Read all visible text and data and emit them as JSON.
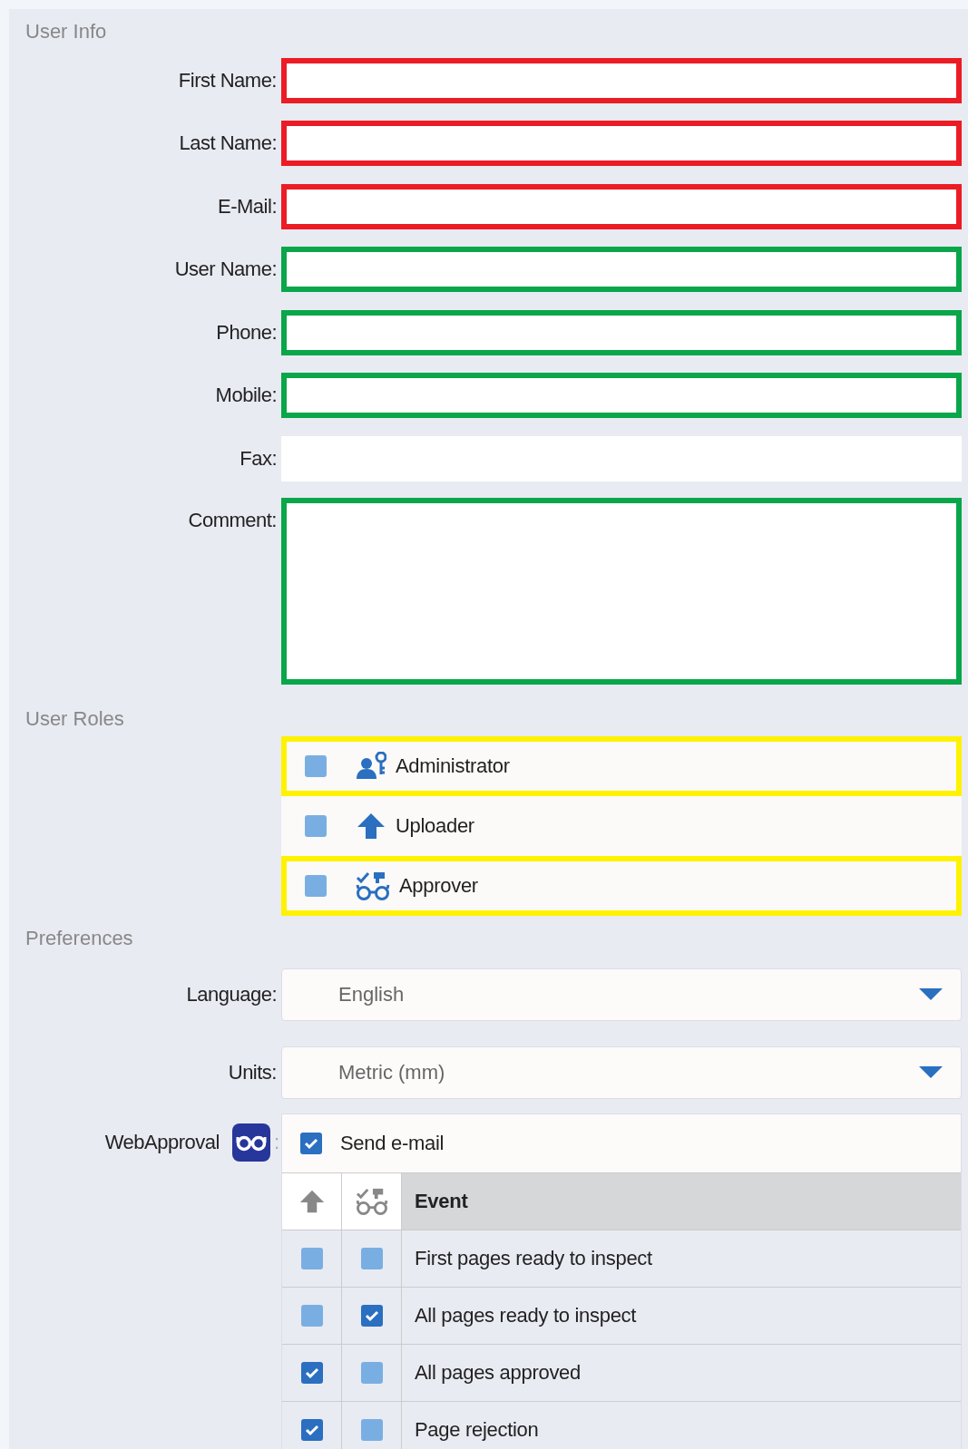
{
  "sections": [
    {
      "title": "User Info"
    },
    {
      "title": "User Roles"
    },
    {
      "title": "Preferences"
    }
  ],
  "fields": [
    {
      "label": "First Name:",
      "kind": "line",
      "color": "#ec1c24"
    },
    {
      "label": "Last Name:",
      "kind": "line",
      "color": "#ec1c24"
    },
    {
      "label": "E-Mail:",
      "kind": "line",
      "color": "#ec1c24"
    },
    {
      "label": "User Name:",
      "kind": "line",
      "color": "#0aa64a"
    },
    {
      "label": "Phone:",
      "kind": "line",
      "color": "#0aa64a"
    },
    {
      "label": "Mobile:",
      "kind": "line",
      "color": "#0aa64a"
    },
    {
      "label": "Fax:",
      "kind": "line"
    },
    {
      "label": "Comment:",
      "kind": "area",
      "color": "#0aa64a"
    }
  ],
  "roles": [
    {
      "label": "Administrator",
      "kind": "admin",
      "checked": false,
      "color": "#fff200"
    },
    {
      "label": "Uploader",
      "kind": "upload",
      "checked": false
    },
    {
      "label": "Approver",
      "kind": "approve",
      "checked": false,
      "color": "#fff200"
    }
  ],
  "preferences": [
    {
      "label": "Language:",
      "value": "English"
    },
    {
      "label": "Units:",
      "value": "Metric (mm)"
    }
  ],
  "webapproval": {
    "label": "WebApproval",
    "separator": ":",
    "send_email": {
      "label": "Send e-mail",
      "checked": true
    }
  },
  "table": {
    "columns": [
      {
        "kind": "upload"
      },
      {
        "kind": "approve"
      },
      {
        "kind": "text",
        "label": "Event"
      }
    ],
    "rows": [
      {
        "uploader": false,
        "approver": false,
        "event": "First pages ready to inspect"
      },
      {
        "uploader": false,
        "approver": true,
        "event": "All pages ready to inspect"
      },
      {
        "uploader": true,
        "approver": false,
        "event": "All pages approved"
      },
      {
        "uploader": true,
        "approver": false,
        "event": "Page rejection"
      }
    ]
  }
}
